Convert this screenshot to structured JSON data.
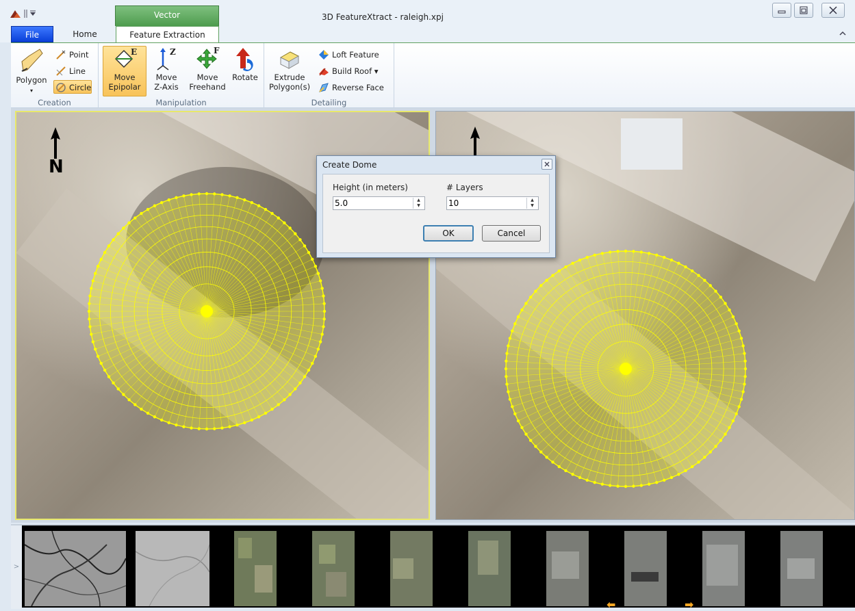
{
  "window": {
    "title": "3D FeatureXtract - raleigh.xpj",
    "context_tab": "Vector"
  },
  "tabs": [
    {
      "label": "File"
    },
    {
      "label": "Home"
    },
    {
      "label": "Feature Extraction"
    }
  ],
  "ribbon": {
    "creation": {
      "group_label": "Creation",
      "polygon": "Polygon",
      "point": "Point",
      "line": "Line",
      "circle": "Circle"
    },
    "manipulation": {
      "group_label": "Manipulation",
      "move_epipolar_1": "Move",
      "move_epipolar_2": "Epipolar",
      "move_z_1": "Move",
      "move_z_2": "Z-Axis",
      "move_free_1": "Move",
      "move_free_2": "Freehand",
      "rotate": "Rotate"
    },
    "detailing": {
      "group_label": "Detailing",
      "extrude_1": "Extrude",
      "extrude_2": "Polygon(s)",
      "loft": "Loft Feature",
      "build_roof": "Build Roof ▾",
      "reverse_face": "Reverse Face"
    }
  },
  "dialog": {
    "title": "Create Dome",
    "height_label": "Height (in meters)",
    "height_value": "5.0",
    "layers_label": "# Layers",
    "layers_value": "10",
    "ok_label": "OK",
    "cancel_label": "Cancel"
  },
  "filmstrip": {
    "toggle": ">",
    "prev_arrow": "⬅",
    "next_arrow": "➡"
  },
  "colors": {
    "mesh": "#ffff00",
    "file_tab": "#1a4fe8",
    "context_tab": "#5aa65a",
    "active_button": "#f8c35a"
  }
}
